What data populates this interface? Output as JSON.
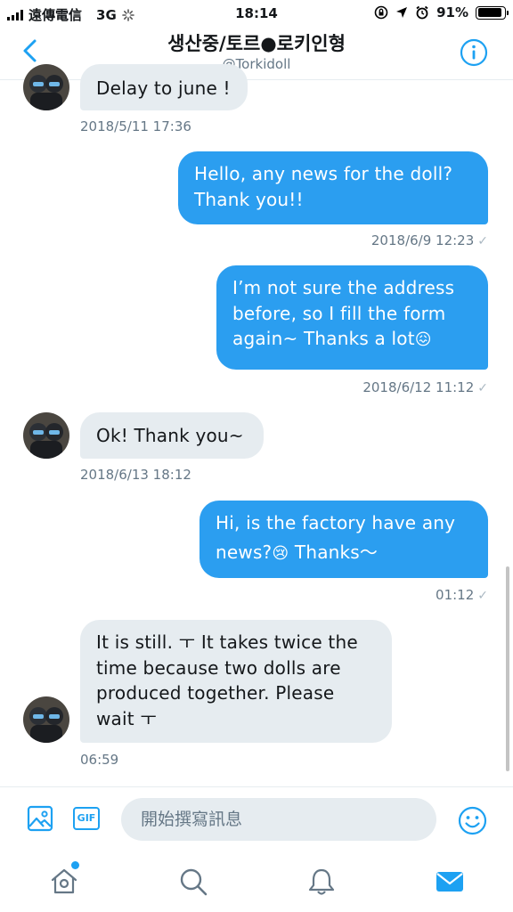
{
  "status_bar": {
    "carrier": "遠傳電信",
    "network": "3G",
    "time": "18:14",
    "battery": "91%",
    "battery_level": 0.91
  },
  "header": {
    "title": "생산중/토르●로키인형",
    "handle": "@Torkidoll"
  },
  "messages": [
    {
      "direction": "in",
      "text": "Delay to june !",
      "timestamp": "2018/5/11 17:36"
    },
    {
      "direction": "out",
      "lines": [
        "Hello, any news for the doll?",
        "Thank you!!"
      ],
      "timestamp": "2018/6/9 12:23"
    },
    {
      "direction": "out",
      "lines": [
        "I’m not sure the address",
        "before, so I fill the form",
        "again~ Thanks a lot"
      ],
      "emoji": "😖",
      "timestamp": "2018/6/12 11:12"
    },
    {
      "direction": "in",
      "text": "Ok! Thank you~",
      "timestamp": "2018/6/13 18:12"
    },
    {
      "direction": "out",
      "lines": [
        "Hi, is the factory have any",
        "news?"
      ],
      "emoji": "😢",
      "line_suffix": " Thanks～",
      "timestamp": "01:12"
    },
    {
      "direction": "in",
      "lines": [
        "It is still. ㅜ It takes twice the",
        "time because two dolls are",
        "produced together. Please",
        "wait ㅜ"
      ],
      "timestamp": "06:59"
    }
  ],
  "composer": {
    "placeholder": "開始撰寫訊息",
    "gif_label": "GIF"
  },
  "colors": {
    "accent": "#1da1f2",
    "incoming_bubble": "#e6ecf0",
    "outgoing_bubble": "#2b9ef0",
    "meta_text": "#657786"
  },
  "icons": [
    "back-chevron-icon",
    "info-icon",
    "image-icon",
    "gif-icon",
    "emoji-icon",
    "home-icon",
    "search-icon",
    "notifications-bell-icon",
    "messages-mail-icon"
  ]
}
